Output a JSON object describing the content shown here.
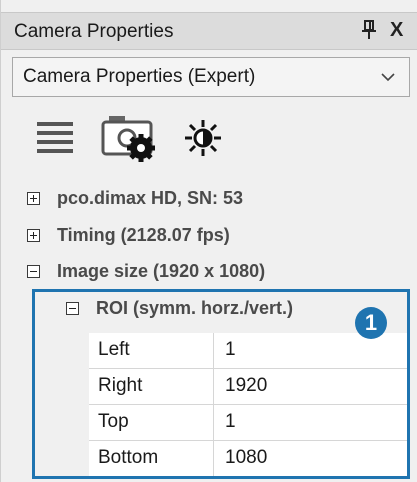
{
  "window": {
    "title": "Camera Properties",
    "pin_glyph": "\u0004",
    "close_glyph": "X"
  },
  "dropdown": {
    "selected": "Camera Properties (Expert)"
  },
  "toolbar": {
    "icons": [
      "list-icon",
      "camera-settings-icon",
      "brightness-icon"
    ]
  },
  "tree": {
    "items": [
      {
        "label": "pco.dimax HD, SN: 53",
        "expanded": false
      },
      {
        "label": "Timing (2128.07 fps)",
        "expanded": false
      },
      {
        "label": "Image size (1920 x 1080)",
        "expanded": true
      }
    ],
    "roi": {
      "label": "ROI (symm. horz./vert.)",
      "rows": [
        {
          "key": "Left",
          "value": "1"
        },
        {
          "key": "Right",
          "value": "1920"
        },
        {
          "key": "Top",
          "value": "1"
        },
        {
          "key": "Bottom",
          "value": "1080"
        }
      ]
    }
  },
  "callout": {
    "number": "1",
    "color": "#1f74b0"
  }
}
